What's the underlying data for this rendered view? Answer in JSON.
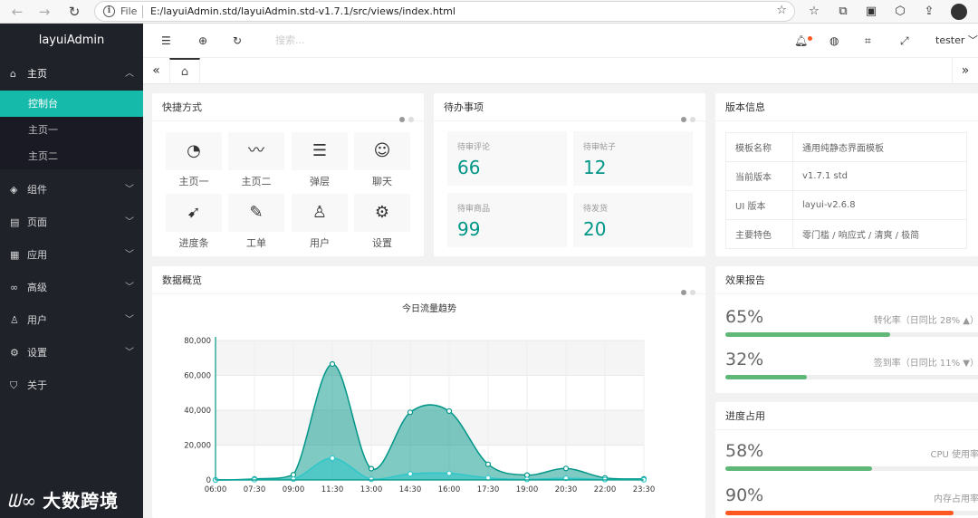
{
  "browser": {
    "file_label": "File",
    "url": "E:/layuiAdmin.std/layuiAdmin.std-v1.7.1/src/views/index.html"
  },
  "sidebar": {
    "logo": "layuiAdmin",
    "home": {
      "label": "主页",
      "subitems": [
        "控制台",
        "主页一",
        "主页二"
      ]
    },
    "items": [
      {
        "label": "组件"
      },
      {
        "label": "页面"
      },
      {
        "label": "应用"
      },
      {
        "label": "高级"
      },
      {
        "label": "用户"
      },
      {
        "label": "设置"
      },
      {
        "label": "关于"
      }
    ]
  },
  "header": {
    "search_placeholder": "搜索...",
    "user": "tester"
  },
  "watermark": "大数跨境",
  "quick": {
    "title": "快捷方式",
    "items": [
      {
        "label": "主页一",
        "icon": "dashboard-icon"
      },
      {
        "label": "主页二",
        "icon": "chart-pulse-icon"
      },
      {
        "label": "弹层",
        "icon": "layers-icon"
      },
      {
        "label": "聊天",
        "icon": "chat-icon"
      },
      {
        "label": "进度条",
        "icon": "compass-icon"
      },
      {
        "label": "工单",
        "icon": "form-edit-icon"
      },
      {
        "label": "用户",
        "icon": "user-icon"
      },
      {
        "label": "设置",
        "icon": "settings-icon"
      }
    ]
  },
  "todo": {
    "title": "待办事项",
    "items": [
      {
        "label": "待审评论",
        "value": "66"
      },
      {
        "label": "待审帖子",
        "value": "12"
      },
      {
        "label": "待审商品",
        "value": "99"
      },
      {
        "label": "待发货",
        "value": "20"
      }
    ]
  },
  "version": {
    "title": "版本信息",
    "rows": [
      {
        "key": "模板名称",
        "value": "通用纯静态界面模板"
      },
      {
        "key": "当前版本",
        "value": "v1.7.1 std"
      },
      {
        "key": "UI 版本",
        "value": "layui-v2.6.8"
      },
      {
        "key": "主要特色",
        "value": "零门槛 / 响应式 / 清爽 / 极简"
      }
    ]
  },
  "overview": {
    "title": "数据概览"
  },
  "report": {
    "title": "效果报告",
    "items": [
      {
        "pct": "65%",
        "label": "转化率（日同比 28% ▲）",
        "value": 65,
        "color": "#5fb878"
      },
      {
        "pct": "32%",
        "label": "签到率（日同比 11% ▼）",
        "value": 32,
        "color": "#5fb878"
      }
    ]
  },
  "progress": {
    "title": "进度占用",
    "items": [
      {
        "pct": "58%",
        "label": "CPU 使用率",
        "value": 58,
        "color": "#5fb878"
      },
      {
        "pct": "90%",
        "label": "内存占用率",
        "value": 90,
        "color": "#ff5722"
      }
    ]
  },
  "chart_data": {
    "type": "area",
    "title": "今日流量趋势",
    "categories": [
      "06:00",
      "07:30",
      "09:00",
      "11:30",
      "13:00",
      "14:30",
      "16:00",
      "17:30",
      "19:00",
      "20:30",
      "22:00",
      "23:30"
    ],
    "y_ticks": [
      "0",
      "20,000",
      "40,000",
      "60,000",
      "80,000"
    ],
    "ylim": [
      0,
      80000
    ],
    "series": [
      {
        "values": [
          0,
          600,
          3000,
          66500,
          6500,
          38800,
          39500,
          9000,
          2800,
          6600,
          1200,
          600
        ],
        "color": "#009688"
      },
      {
        "values": [
          0,
          150,
          500,
          12500,
          400,
          3500,
          3800,
          1200,
          300,
          1000,
          200,
          100
        ],
        "color": "#2ec7c9"
      }
    ],
    "grid": true
  }
}
